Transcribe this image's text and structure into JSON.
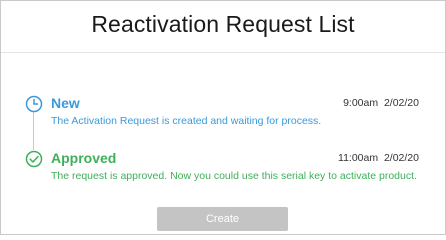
{
  "dialog": {
    "title": "Reactivation Request List"
  },
  "timeline": [
    {
      "status": "New",
      "description": "The Activation Request is created and waiting for process.",
      "time": "9:00am",
      "date": "2/02/20",
      "icon": "clock-icon",
      "color": "#3a9ad9"
    },
    {
      "status": "Approved",
      "description": "The request is approved. Now you could use this serial key to activate product.",
      "time": "11:00am",
      "date": "2/02/20",
      "icon": "check-circle-icon",
      "color": "#3fb05a"
    }
  ],
  "actions": {
    "create_label": "Create"
  }
}
